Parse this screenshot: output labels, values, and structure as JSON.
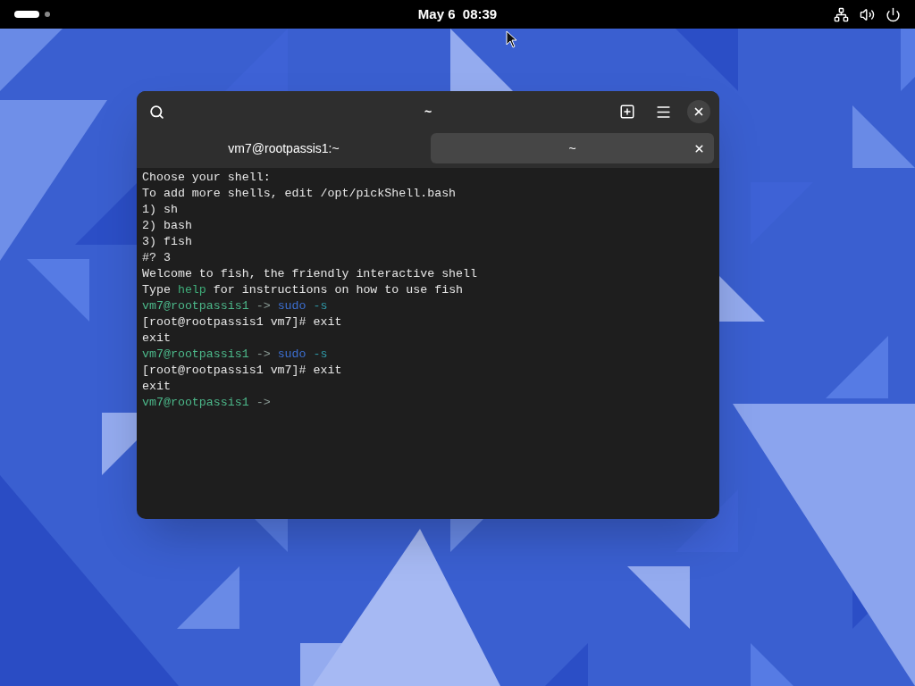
{
  "top_bar": {
    "clock": "May 6  08:39"
  },
  "window": {
    "title": "~",
    "tabs": [
      {
        "label": "vm7@rootpassis1:~",
        "selected": false
      },
      {
        "label": "~",
        "selected": true
      }
    ],
    "terminal_lines": [
      [
        {
          "text": "Choose your shell:",
          "kind": "plain"
        }
      ],
      [
        {
          "text": "To add more shells, edit /opt/pickShell.bash",
          "kind": "plain"
        }
      ],
      [
        {
          "text": "1) sh",
          "kind": "plain"
        }
      ],
      [
        {
          "text": "2) bash",
          "kind": "plain"
        }
      ],
      [
        {
          "text": "3) fish",
          "kind": "plain"
        }
      ],
      [
        {
          "text": "#? 3",
          "kind": "plain"
        }
      ],
      [
        {
          "text": "Welcome to fish, the friendly interactive shell",
          "kind": "plain"
        }
      ],
      [
        {
          "text": "Type ",
          "kind": "plain"
        },
        {
          "text": "help",
          "kind": "hint"
        },
        {
          "text": " for instructions on how to use fish",
          "kind": "plain"
        }
      ],
      [
        {
          "text": "vm7@rootpassis1",
          "kind": "user"
        },
        {
          "text": " -> ",
          "kind": "arrow"
        },
        {
          "text": "sudo",
          "kind": "command"
        },
        {
          "text": " -s",
          "kind": "option"
        }
      ],
      [
        {
          "text": "[root@rootpassis1 vm7]# exit",
          "kind": "plain"
        }
      ],
      [
        {
          "text": "exit",
          "kind": "plain"
        }
      ],
      [
        {
          "text": "vm7@rootpassis1",
          "kind": "user"
        },
        {
          "text": " -> ",
          "kind": "arrow"
        },
        {
          "text": "sudo",
          "kind": "command"
        },
        {
          "text": " -s",
          "kind": "option"
        }
      ],
      [
        {
          "text": "[root@rootpassis1 vm7]# exit",
          "kind": "plain"
        }
      ],
      [
        {
          "text": "exit",
          "kind": "plain"
        }
      ],
      [
        {
          "text": "vm7@rootpassis1",
          "kind": "user"
        },
        {
          "text": " ->",
          "kind": "arrow"
        }
      ]
    ]
  }
}
